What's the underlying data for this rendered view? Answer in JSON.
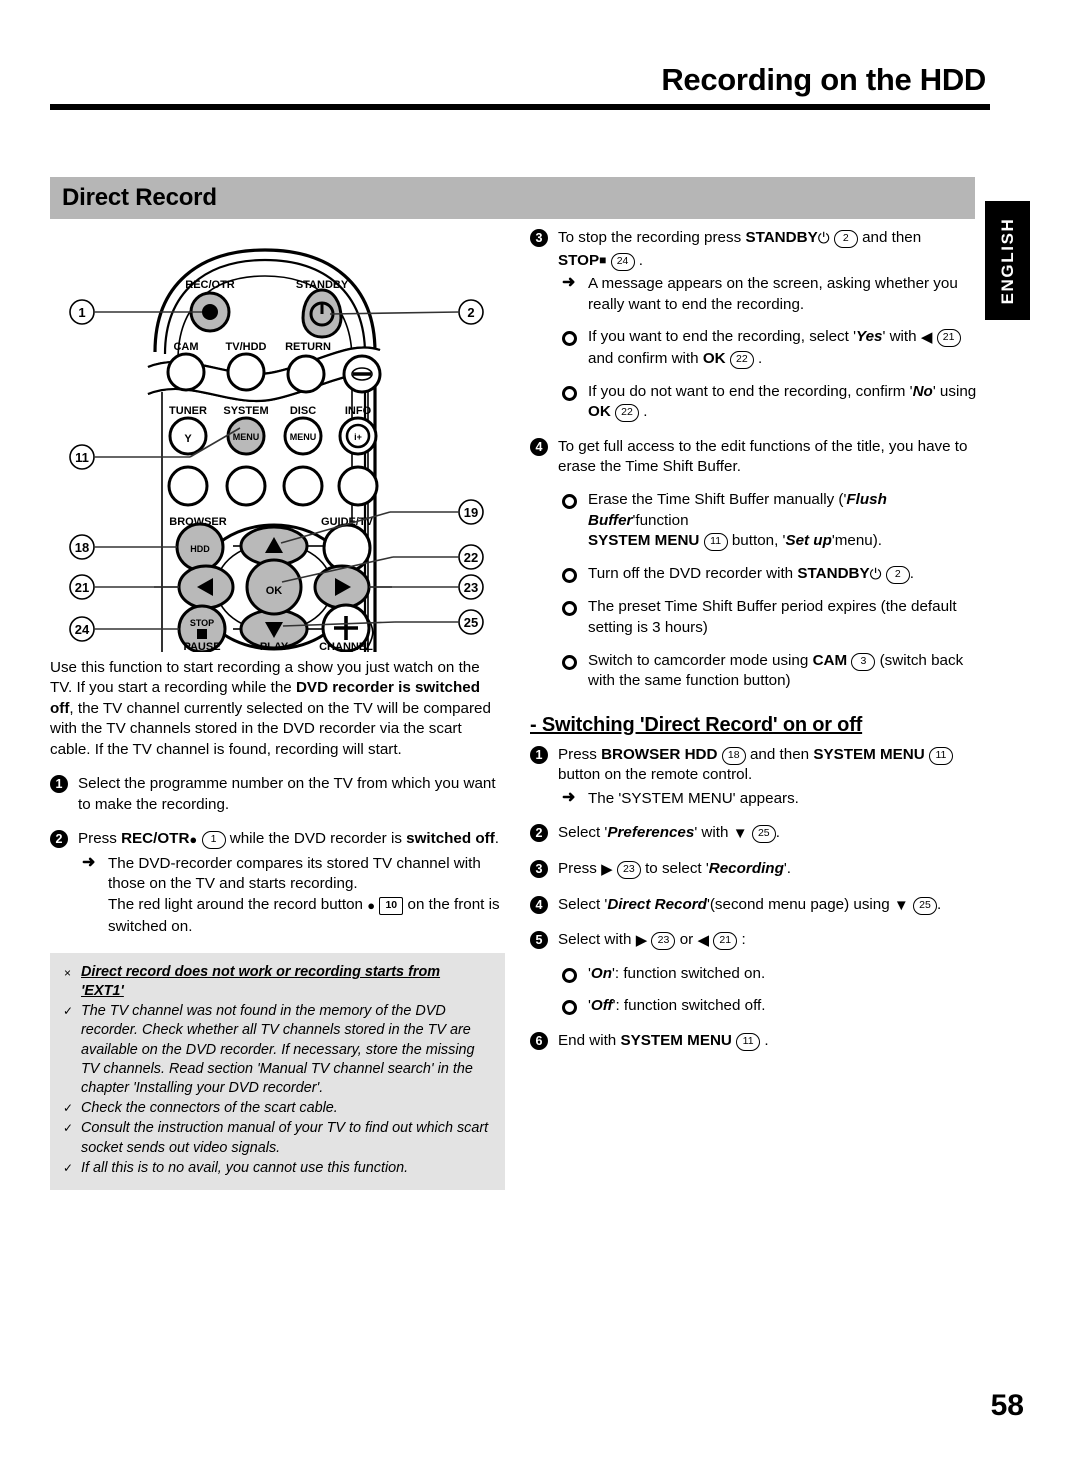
{
  "header": {
    "title": "Recording on the HDD"
  },
  "side_tab": {
    "label": "ENGLISH"
  },
  "section": {
    "title": "Direct Record"
  },
  "figure": {
    "name": "remote-control-diagram",
    "button_labels": [
      "REC/OTR",
      "STANDBY",
      "CAM",
      "TV/HDD",
      "RETURN",
      "TUNER",
      "SYSTEM",
      "DISC",
      "INFO",
      "BROWSER",
      "GUIDE/TV",
      "HDD",
      "OK",
      "STOP",
      "PAUSE",
      "PLAY",
      "CHANNEL",
      "MENU"
    ],
    "callouts": [
      "1",
      "2",
      "11",
      "18",
      "19",
      "21",
      "22",
      "23",
      "24",
      "25"
    ]
  },
  "left": {
    "intro": [
      "Use this function to start recording a show you just watch on the TV.",
      "If you start a recording while the ",
      "DVD recorder is switched off",
      ", the TV channel currently selected on the TV will be compared with the TV channels stored in the DVD recorder via the scart cable.",
      "If the TV channel is found, recording will start."
    ],
    "step1": {
      "num": "1",
      "text": "Select the programme number on the TV from which you want to make the recording."
    },
    "step2": {
      "num": "2",
      "press": "Press",
      "key": "REC/OTR",
      "keyref": "1",
      "mid": "while the DVD recorder is",
      "bold_tail": "switched off",
      "period": ".",
      "arrow_line1": "The DVD-recorder compares its stored TV channel with those on the TV and starts recording.",
      "arrow_line2_a": "The red light around the record button",
      "arrow_line2_ref": "10",
      "arrow_line2_b": "on the front is switched on."
    },
    "note": {
      "marker": "×",
      "title_line1": "Direct record does not work or recording starts from",
      "title_line2": "'EXT1'",
      "items": [
        "The TV channel was not found in the memory of the DVD recorder. Check whether all TV channels stored in the TV are available on the DVD recorder. If necessary, store the missing TV channels. Read section 'Manual TV channel search' in the chapter 'Installing your DVD recorder'.",
        "Check the connectors of the scart cable.",
        "Consult the instruction manual of your TV to find out which scart socket sends out video signals.",
        "If all this is to no avail, you cannot use this function."
      ],
      "check": "✓"
    }
  },
  "right": {
    "step3": {
      "num": "3",
      "a": "To stop the recording press",
      "key1": "STANDBY",
      "ref1": "2",
      "b": "and then",
      "key2": "STOP",
      "ref2": "24",
      "period": ".",
      "arrow": "A message appears on the screen, asking whether you really want to end the recording.",
      "bullet1_a": "If you want to end the recording, select '",
      "bullet1_yes": "Yes",
      "bullet1_b": "' with",
      "bullet1_ref1": "21",
      "bullet1_c": "and confirm with",
      "bullet1_ok": "OK",
      "bullet1_ref2": "22",
      "bullet2_a": "If you do not want to end the recording, confirm '",
      "bullet2_no": "No",
      "bullet2_b": "' using",
      "bullet2_ok": "OK",
      "bullet2_ref": "22"
    },
    "step4": {
      "num": "4",
      "text": "To get full access to the edit functions of the title, you have to erase the Time Shift Buffer.",
      "bullet1_a": "Erase the Time Shift Buffer manually ('",
      "bullet1_flush": "Flush Buffer",
      "bullet1_b": "'function",
      "bullet1_key": "SYSTEM MENU",
      "bullet1_ref": "11",
      "bullet1_c": "button, '",
      "bullet1_setup": "Set up",
      "bullet1_d": "'menu).",
      "bullet2_a": "Turn off the DVD recorder with",
      "bullet2_key": "STANDBY",
      "bullet2_ref": "2",
      "bullet2_period": ".",
      "bullet3": "The preset Time Shift Buffer period expires (the default setting is 3 hours)",
      "bullet4_a": "Switch to camcorder mode using",
      "bullet4_key": "CAM",
      "bullet4_ref": "3",
      "bullet4_b": "(switch back with the same function button)"
    },
    "subheading": "- Switching 'Direct Record' on or off",
    "sw_step1": {
      "num": "1",
      "a": "Press",
      "key1": "BROWSER HDD",
      "ref1": "18",
      "b": "and then",
      "key2": "SYSTEM MENU",
      "ref2": "11",
      "c": "button on the remote control.",
      "arrow": "The 'SYSTEM MENU' appears."
    },
    "sw_step2": {
      "num": "2",
      "a": "Select '",
      "em": "Preferences",
      "b": "' with",
      "arrow_sym": "▼",
      "ref": "25",
      "c": "."
    },
    "sw_step3": {
      "num": "3",
      "a": "Press",
      "arrow_sym": "▶",
      "ref": "23",
      "b": "to select '",
      "em": "Recording",
      "c": "'."
    },
    "sw_step4": {
      "num": "4",
      "a": "Select '",
      "em": "Direct Record",
      "b": "'(second menu page) using",
      "arrow_sym": "▼",
      "ref": "25",
      "c": "."
    },
    "sw_step5": {
      "num": "5",
      "a": "Select with",
      "sym1": "▶",
      "ref1": "23",
      "b": "or",
      "sym2": "◀",
      "ref2": "21",
      "c": ":",
      "opt1_q": "'",
      "opt1_em": "On",
      "opt1_t": "': function switched on.",
      "opt2_q": "'",
      "opt2_em": "Off",
      "opt2_t": "': function switched off."
    },
    "sw_step6": {
      "num": "6",
      "a": "End with",
      "key": "SYSTEM MENU",
      "ref": "11",
      "b": "."
    }
  },
  "footer": {
    "page_number": "58"
  },
  "colors": {
    "section_bar": "#b6b6b6",
    "note_box": "#e3e3e3",
    "tab": "#000000",
    "text": "#000000"
  }
}
